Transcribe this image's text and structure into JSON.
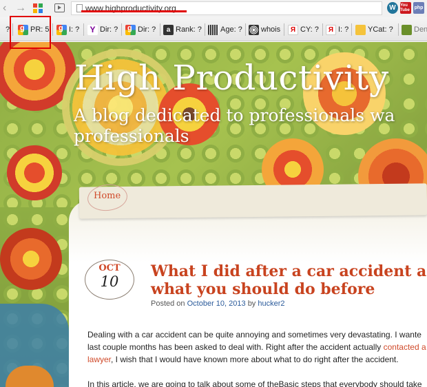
{
  "browser": {
    "back_glyph": "‹",
    "forward_glyph": "→",
    "url": "www.highproductivity.org",
    "extensions": [
      {
        "name": "wordpress",
        "label": "W",
        "color": "#21759b"
      },
      {
        "name": "youtube",
        "label": "You Tube",
        "color": "#cc181e"
      },
      {
        "name": "php",
        "label": "php",
        "color": "#6c7eb7"
      }
    ]
  },
  "seo_toolbar": {
    "lead_label": "?",
    "items": [
      {
        "id": "google-pr",
        "label": "PR: 5",
        "icon": "google-icon"
      },
      {
        "id": "google-index",
        "label": "I: ?",
        "icon": "google-icon"
      },
      {
        "id": "yahoo-dir",
        "label": "Dir: ?",
        "icon": "yahoo-icon"
      },
      {
        "id": "google-dir",
        "label": "Dir: ?",
        "icon": "google-icon"
      },
      {
        "id": "alexa-rank",
        "label": "Rank: ?",
        "icon": "alexa-icon"
      },
      {
        "id": "age",
        "label": "Age: ?",
        "icon": "barcode-icon"
      },
      {
        "id": "whois",
        "label": "whois",
        "icon": "whois-icon"
      },
      {
        "id": "yandex-cy",
        "label": "CY: ?",
        "icon": "yandex-icon"
      },
      {
        "id": "yandex-index",
        "label": "I: ?",
        "icon": "yandex-icon"
      },
      {
        "id": "yahoo-cat",
        "label": "YCat: ?",
        "icon": "lock-icon"
      },
      {
        "id": "dent",
        "label": "Den",
        "icon": "dent-icon"
      }
    ]
  },
  "site": {
    "title": "High Productivity",
    "tagline_line1": "A blog dedicated to professionals wa",
    "tagline_line2": "professionals",
    "nav_home": "Home"
  },
  "post": {
    "month": "OCT",
    "day": "10",
    "title_line1": "What I did after a car accident an",
    "title_line2": "what you should do before",
    "meta_prefix": "Posted on",
    "date": "October 10, 2013",
    "meta_by": "by",
    "author": "hucker2",
    "p1_line1": "Dealing with a car accident can be quite annoying and sometimes very devastating. I wante",
    "p1_line2_start": "last couple months has been asked to deal with. Right after the accident actually",
    "p1_line2_link": "contacted a",
    "p1_line3_link": "lawyer",
    "p1_line3_rest": ", I wish that I would have known more about what to do right after the accident.",
    "p2_line1": "In this article, we are going to talk about some of theBasic steps that everybody should take"
  },
  "colors": {
    "accent_red": "#c8431f",
    "highlight_red": "#e00000",
    "link_blue": "#2a5a9a"
  }
}
